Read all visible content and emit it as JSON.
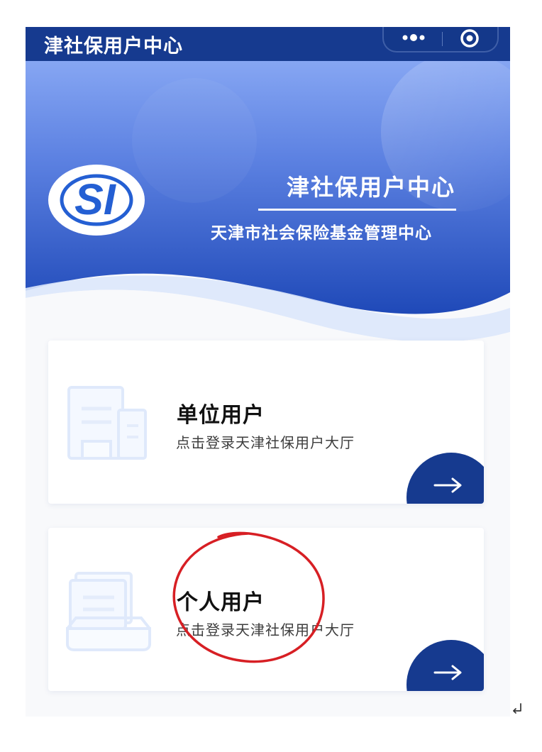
{
  "topbar": {
    "title": "津社保用户中心",
    "more_icon": "ellipsis-icon",
    "target_icon": "target-icon"
  },
  "hero": {
    "logo_text": "SI",
    "title": "津社保用户中心",
    "subtitle": "天津市社会保险基金管理中心"
  },
  "cards": [
    {
      "title": "单位用户",
      "subtitle": "点击登录天津社保用户大厅",
      "icon": "building-icon",
      "button_icon": "arrow-right-icon"
    },
    {
      "title": "个人用户",
      "subtitle": "点击登录天津社保用户大厅",
      "icon": "document-stack-icon",
      "button_icon": "arrow-right-icon"
    }
  ],
  "colors": {
    "header_dark_blue": "#163a8f",
    "hero_light_blue": "#7f9ff1",
    "hero_mid_blue": "#3d67d4",
    "page_background": "#f8f9fb",
    "annotation_red": "#d71f24"
  }
}
